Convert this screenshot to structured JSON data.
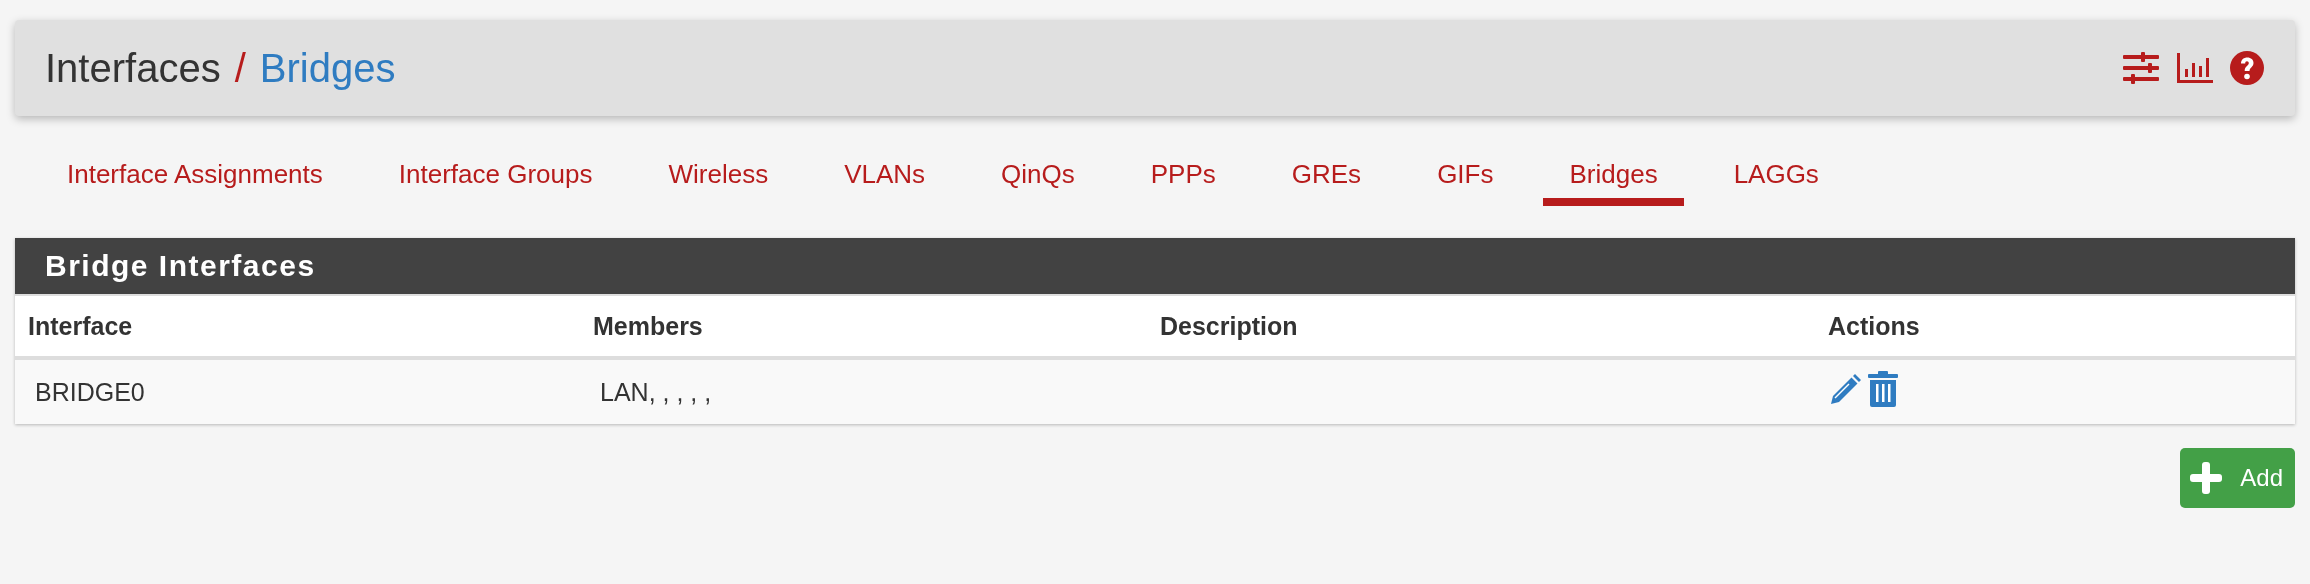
{
  "breadcrumb": {
    "section": "Interfaces",
    "separator": "/",
    "page": "Bridges"
  },
  "tabs": [
    {
      "label": "Interface Assignments",
      "selected": false
    },
    {
      "label": "Interface Groups",
      "selected": false
    },
    {
      "label": "Wireless",
      "selected": false
    },
    {
      "label": "VLANs",
      "selected": false
    },
    {
      "label": "QinQs",
      "selected": false
    },
    {
      "label": "PPPs",
      "selected": false
    },
    {
      "label": "GREs",
      "selected": false
    },
    {
      "label": "GIFs",
      "selected": false
    },
    {
      "label": "Bridges",
      "selected": true
    },
    {
      "label": "LAGGs",
      "selected": false
    }
  ],
  "table": {
    "title": "Bridge Interfaces",
    "columns": [
      "Interface",
      "Members",
      "Description",
      "Actions"
    ],
    "rows": [
      {
        "interface": "BRIDGE0",
        "members": "LAN, , , , ,",
        "description": ""
      }
    ]
  },
  "add_button": {
    "label": "Add"
  }
}
